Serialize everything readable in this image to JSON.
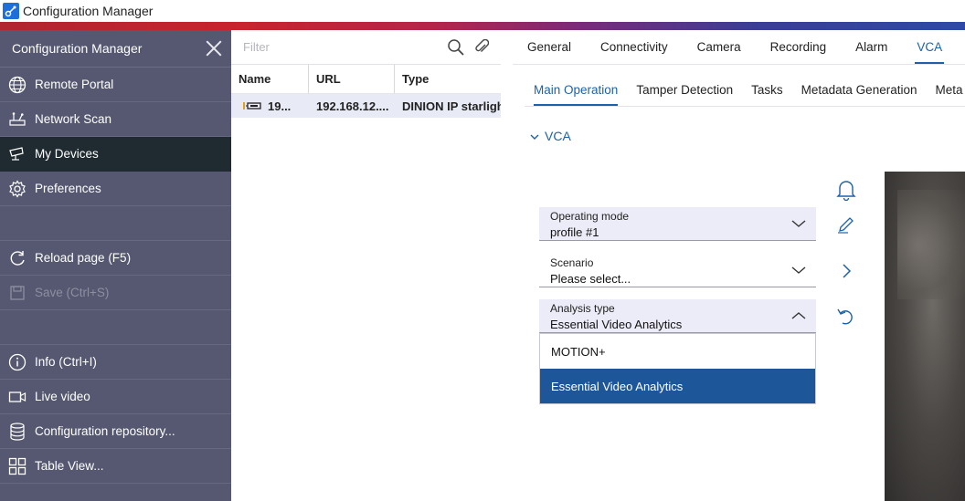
{
  "window": {
    "title": "Configuration Manager"
  },
  "sidebar": {
    "title": "Configuration Manager",
    "items": [
      {
        "label": "Remote Portal",
        "icon": "globe-icon"
      },
      {
        "label": "Network Scan",
        "icon": "network-scan-icon"
      },
      {
        "label": "My Devices",
        "icon": "camera-icon"
      },
      {
        "label": "Preferences",
        "icon": "gear-icon"
      },
      {
        "label": "Reload page (F5)",
        "icon": "reload-icon"
      },
      {
        "label": "Save (Ctrl+S)",
        "icon": "save-icon"
      },
      {
        "label": "Info (Ctrl+I)",
        "icon": "info-icon"
      },
      {
        "label": "Live video",
        "icon": "video-icon"
      },
      {
        "label": "Configuration repository...",
        "icon": "database-icon"
      },
      {
        "label": "Table View...",
        "icon": "grid-icon"
      }
    ]
  },
  "devices": {
    "filter_placeholder": "Filter",
    "columns": [
      "Name",
      "URL",
      "Type"
    ],
    "rows": [
      {
        "name": "19...",
        "url": "192.168.12....",
        "type": "DINION IP starlight"
      }
    ]
  },
  "config": {
    "tabs": [
      "General",
      "Connectivity",
      "Camera",
      "Recording",
      "Alarm",
      "VCA"
    ],
    "active_tab": "VCA",
    "subtabs": [
      "Main Operation",
      "Tamper Detection",
      "Tasks",
      "Metadata Generation",
      "Meta"
    ],
    "active_subtab": "Main Operation",
    "section_title": "VCA",
    "operating_mode": {
      "label": "Operating mode",
      "value": "profile #1"
    },
    "scenario": {
      "label": "Scenario",
      "value": "Please select..."
    },
    "analysis_type": {
      "label": "Analysis type",
      "value": "Essential Video Analytics",
      "options": [
        "MOTION+",
        "Essential Video Analytics"
      ],
      "selected": "Essential Video Analytics"
    }
  },
  "colors": {
    "accent": "#1d62a8",
    "sidebar_bg": "#555870",
    "sidebar_active": "#1f2b30",
    "selected_option": "#1e5799"
  }
}
